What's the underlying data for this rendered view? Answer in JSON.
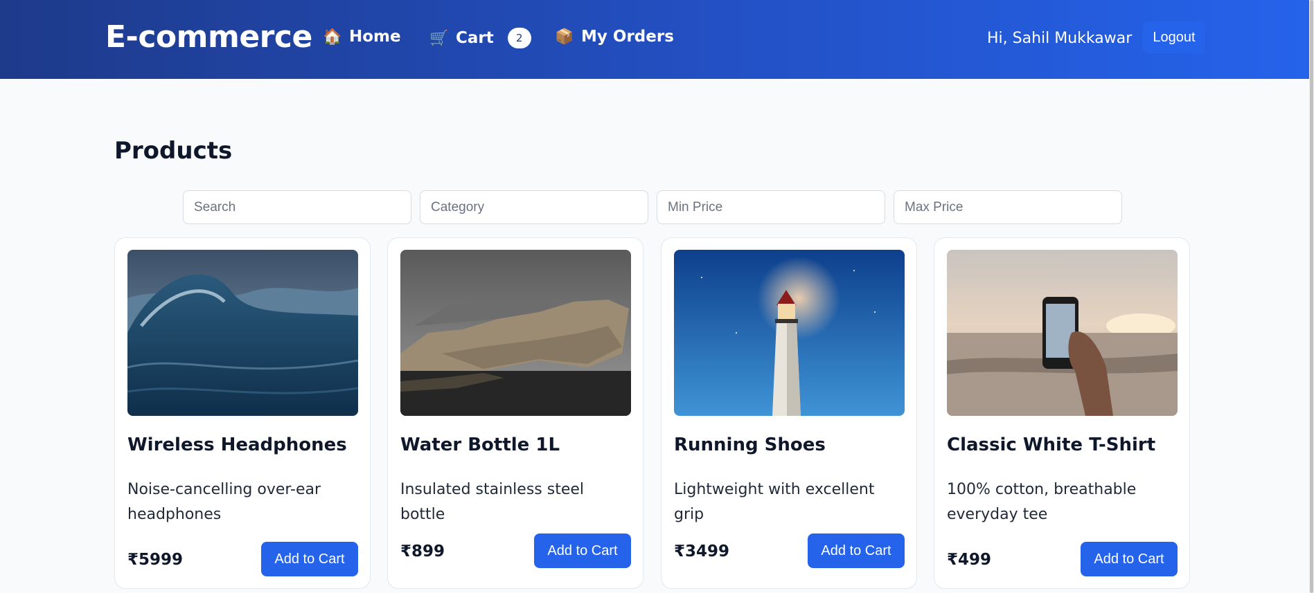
{
  "header": {
    "brand": "E-commerce",
    "nav": {
      "home": {
        "icon": "house-emoji",
        "label": "Home"
      },
      "cart": {
        "icon": "shopping-cart-emoji",
        "label": "Cart",
        "count": "2"
      },
      "orders": {
        "icon": "package-emoji",
        "label": "My Orders"
      }
    },
    "greeting": "Hi, Sahil Mukkawar",
    "logout_label": "Logout"
  },
  "main": {
    "title": "Products",
    "filters": {
      "search_placeholder": "Search",
      "category_placeholder": "Category",
      "min_price_placeholder": "Min Price",
      "max_price_placeholder": "Max Price"
    },
    "products": [
      {
        "name": "Wireless Headphones",
        "description": "Noise-cancelling over-ear headphones",
        "price": "₹5999",
        "button": "Add to Cart",
        "image": "ocean-wave-photo"
      },
      {
        "name": "Water Bottle 1L",
        "description": "Insulated stainless steel bottle",
        "price": "₹899",
        "button": "Add to Cart",
        "image": "coastal-cliff-photo"
      },
      {
        "name": "Running Shoes",
        "description": "Lightweight with excellent grip",
        "price": "₹3499",
        "button": "Add to Cart",
        "image": "lighthouse-photo"
      },
      {
        "name": "Classic White T-Shirt",
        "description": "100% cotton, breathable everyday tee",
        "price": "₹499",
        "button": "Add to Cart",
        "image": "phone-at-beach-photo"
      }
    ]
  },
  "colors": {
    "header_start": "#1e3a8a",
    "header_end": "#2563eb",
    "accent": "#2563eb",
    "page_bg": "#f8fafc"
  }
}
